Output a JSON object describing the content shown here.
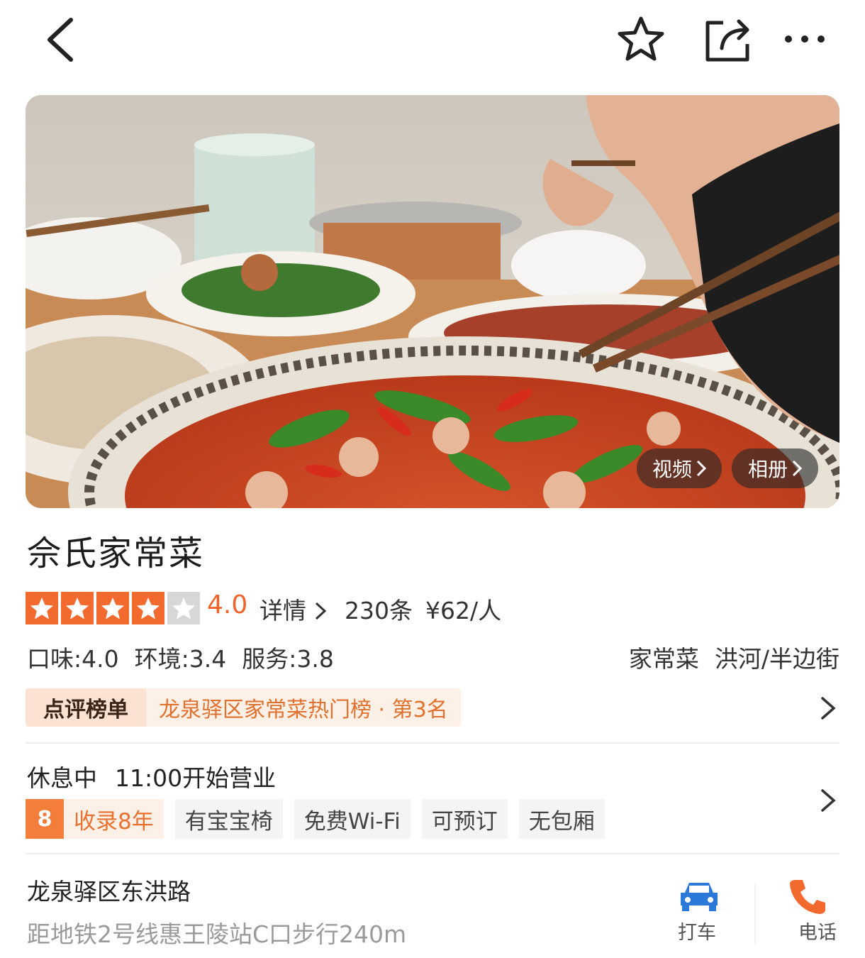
{
  "top_bar": {
    "back_icon": "chevron-left-icon",
    "favorite_icon": "star-outline-icon",
    "share_icon": "share-icon",
    "more_icon": "more-horizontal-icon"
  },
  "hero": {
    "video_label": "视频",
    "album_label": "相册"
  },
  "shop": {
    "name": "佘氏家常菜",
    "stars_filled": 4,
    "stars_total": 5,
    "score": "4.0",
    "detail_label": "详情",
    "review_count": "230条",
    "price_per_person": "¥62/人",
    "sub_scores": {
      "taste": "口味:4.0",
      "environment": "环境:3.4",
      "service": "服务:3.8"
    },
    "category": "家常菜",
    "area": "洪河/半边街",
    "accent_color": "#f26a2e"
  },
  "ranking": {
    "badge": "点评榜单",
    "text": "龙泉驿区家常菜热门榜 · 第3名"
  },
  "hours": {
    "status": "休息中",
    "open_time": "11:00开始营业"
  },
  "tags": {
    "years_number": "8",
    "years_label": "收录8年",
    "items": [
      "有宝宝椅",
      "免费Wi-Fi",
      "可预订",
      "无包厢"
    ]
  },
  "address": {
    "street": "龙泉驿区东洪路",
    "metro": "距地铁2号线惠王陵站C口步行240m"
  },
  "actions": {
    "taxi_label": "打车",
    "call_label": "电话"
  }
}
